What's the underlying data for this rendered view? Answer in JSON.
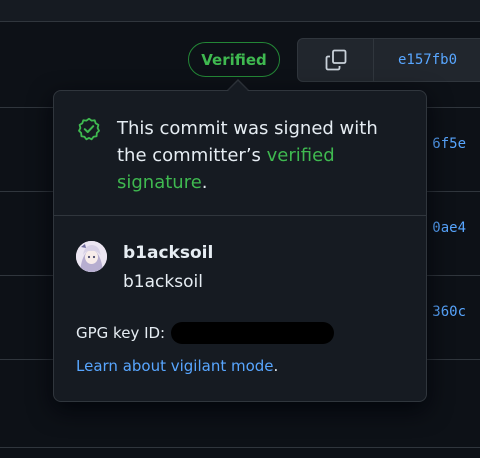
{
  "header": {
    "verified_label": "Verified",
    "commit_sha": "e157fb0"
  },
  "rows": [
    {
      "sha_partial": "6f5e"
    },
    {
      "sha_partial": "0ae4"
    },
    {
      "sha_partial": "360c"
    }
  ],
  "popover": {
    "message_prefix": "This commit was signed with the committer’s ",
    "message_link": "verified signature",
    "message_suffix": ".",
    "user": {
      "login": "b1acksoil",
      "name": "b1acksoil"
    },
    "gpg_label": "GPG key ID:",
    "learn_link": "Learn about vigilant mode",
    "learn_suffix": "."
  },
  "colors": {
    "background": "#0d1117",
    "surface": "#161b22",
    "border": "#30363d",
    "success": "#3fb950",
    "link": "#58a6ff"
  },
  "icons": {
    "shield": "verified-shield-icon",
    "copy": "copy-icon",
    "avatar": "avatar"
  }
}
